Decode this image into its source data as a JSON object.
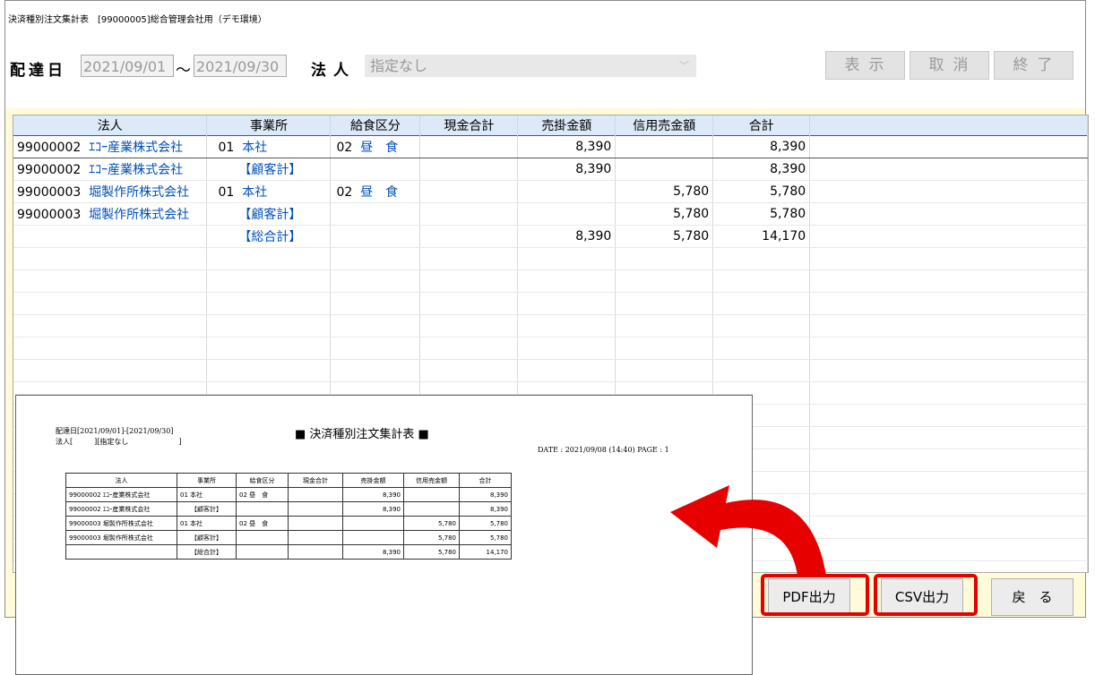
{
  "window": {
    "title": "決済種別注文集計表　[99000005]総合管理会社用（デモ環境）"
  },
  "filters": {
    "delivery_label": "配達日",
    "date_from": "2021/09/01",
    "tilde": "～",
    "date_to": "2021/09/30",
    "corp_label": "法人",
    "corp_value": "指定なし"
  },
  "toolbar": {
    "show": "表示",
    "cancel": "取消",
    "exit": "終了"
  },
  "table": {
    "headers": [
      "法人",
      "事業所",
      "給食区分",
      "現金合計",
      "売掛金額",
      "信用売金額",
      "合計"
    ],
    "rows": [
      {
        "corp_code": "99000002",
        "corp_name": "ｴｺｰ産業株式会社",
        "office_code": "01",
        "office": "本社",
        "meal_code": "02",
        "meal": "昼　食",
        "cash": "",
        "receivable": "8,390",
        "credit": "",
        "total": "8,390"
      },
      {
        "corp_code": "99000002",
        "corp_name": "ｴｺｰ産業株式会社",
        "office_code": "",
        "office": "【顧客計】",
        "meal_code": "",
        "meal": "",
        "cash": "",
        "receivable": "8,390",
        "credit": "",
        "total": "8,390"
      },
      {
        "corp_code": "99000003",
        "corp_name": "堀製作所株式会社",
        "office_code": "01",
        "office": "本社",
        "meal_code": "02",
        "meal": "昼　食",
        "cash": "",
        "receivable": "",
        "credit": "5,780",
        "total": "5,780"
      },
      {
        "corp_code": "99000003",
        "corp_name": "堀製作所株式会社",
        "office_code": "",
        "office": "【顧客計】",
        "meal_code": "",
        "meal": "",
        "cash": "",
        "receivable": "",
        "credit": "5,780",
        "total": "5,780"
      },
      {
        "corp_code": "",
        "corp_name": "",
        "office_code": "",
        "office": "【総合計】",
        "meal_code": "",
        "meal": "",
        "cash": "",
        "receivable": "8,390",
        "credit": "5,780",
        "total": "14,170"
      }
    ]
  },
  "bottom": {
    "pdf": "PDF出力",
    "csv": "CSV出力",
    "back": "戻　る"
  },
  "preview": {
    "header_line1": "配達日[2021/09/01]-[2021/09/30]",
    "header_line2": "法人[　　　][指定なし　　　　　　　]",
    "title": "■ 決済種別注文集計表 ■",
    "date_page": "DATE : 2021/09/08 (14:40)  PAGE :    1",
    "headers": [
      "法人",
      "事業所",
      "給食区分",
      "現金合計",
      "売掛金額",
      "信用売金額",
      "合計"
    ],
    "rows": [
      [
        "99000002 ｴｺｰ産業株式会社",
        "01 本社",
        "02 昼　食",
        "",
        "8,390",
        "",
        "8,390"
      ],
      [
        "99000002 ｴｺｰ産業株式会社",
        "【顧客計】",
        "",
        "",
        "8,390",
        "",
        "8,390"
      ],
      [
        "99000003 堀製作所株式会社",
        "01 本社",
        "02 昼　食",
        "",
        "",
        "5,780",
        "5,780"
      ],
      [
        "99000003 堀製作所株式会社",
        "【顧客計】",
        "",
        "",
        "",
        "5,780",
        "5,780"
      ],
      [
        "",
        "【総合計】",
        "",
        "",
        "8,390",
        "5,780",
        "14,170"
      ]
    ]
  },
  "colors": {
    "accent_red": "#e60000",
    "header_blue": "#dce9f8",
    "window_bg": "#fffbd9",
    "link_blue": "#0050b8"
  }
}
